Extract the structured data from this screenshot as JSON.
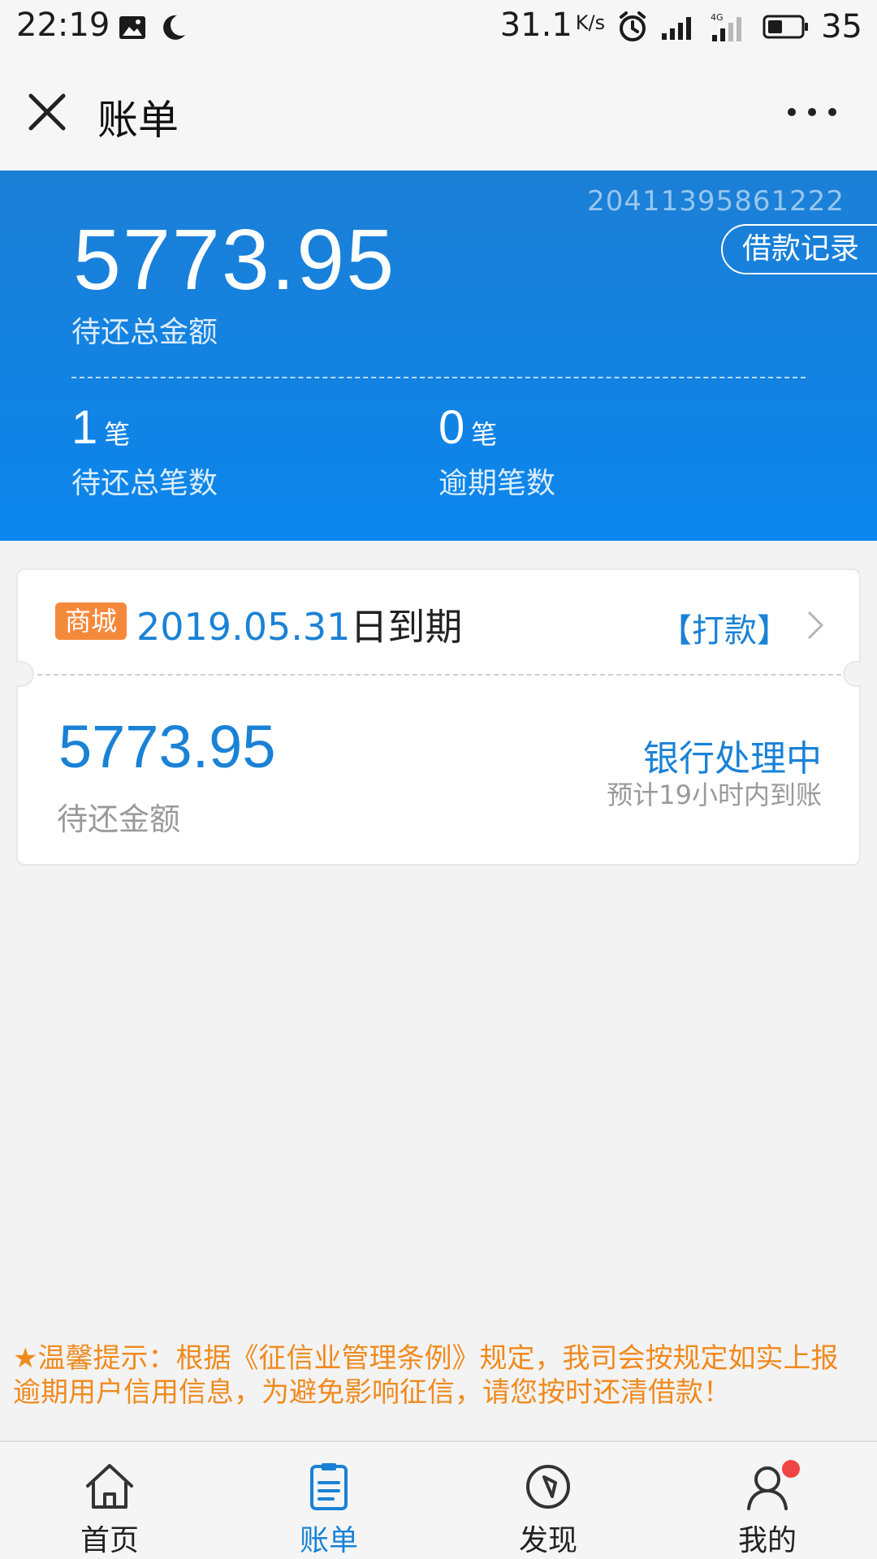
{
  "status_bar": {
    "time": "22:19",
    "speed": "31.1",
    "speed_unit": "K/s",
    "battery": "35"
  },
  "header": {
    "title": "账单"
  },
  "summary": {
    "account_id": "20411395861222",
    "total_amount": "5773.95",
    "total_amount_label": "待还总金额",
    "borrow_record_label": "借款记录",
    "pending_count": "1",
    "pending_unit": "笔",
    "pending_label": "待还总笔数",
    "overdue_count": "0",
    "overdue_unit": "笔",
    "overdue_label": "逾期笔数"
  },
  "bill_card": {
    "tag": "商城",
    "due_date": "2019.05.31",
    "due_suffix": "日到期",
    "pay_label": "【打款】",
    "amount": "5773.95",
    "amount_label": "待还金额",
    "status": "银行处理中",
    "status_sub": "预计19小时内到账"
  },
  "notice": {
    "text": "★温馨提示：根据《征信业管理条例》规定，我司会按规定如实上报逾期用户信用信息，为避免影响征信，请您按时还清借款！"
  },
  "bottom_nav": {
    "items": [
      {
        "label": "首页",
        "icon": "home-icon"
      },
      {
        "label": "账单",
        "icon": "bill-icon"
      },
      {
        "label": "发现",
        "icon": "compass-icon"
      },
      {
        "label": "我的",
        "icon": "user-icon"
      }
    ]
  },
  "colors": {
    "primary_blue": "#1a82d6",
    "hero_blue": "#0b86ec",
    "tag_orange": "#f5893b",
    "notice_orange": "#f08a1e",
    "badge_red": "#f04545"
  }
}
